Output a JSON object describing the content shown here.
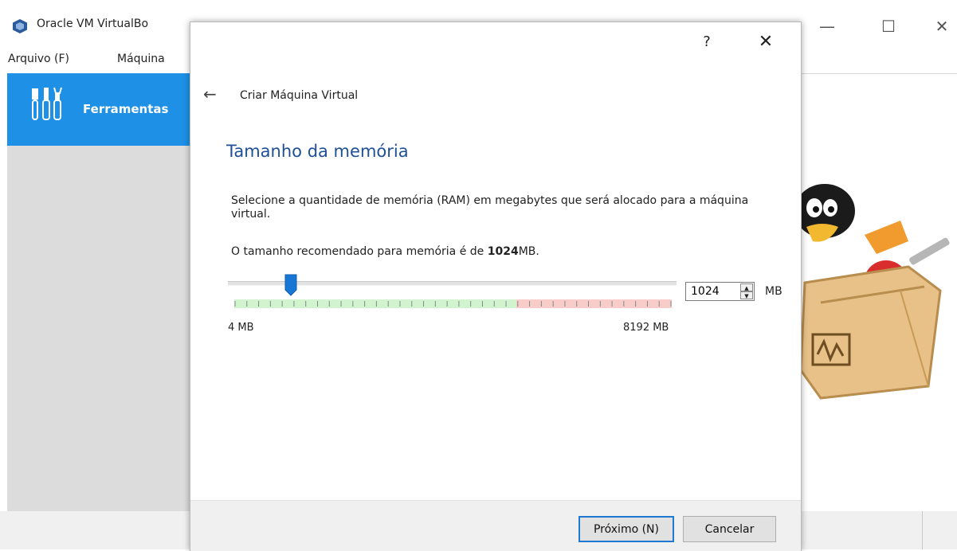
{
  "main_window": {
    "title": "Oracle VM VirtualBo",
    "controls": {
      "minimize": "—",
      "maximize": "☐",
      "close": "✕"
    },
    "menu": {
      "arquivo": "Arquivo (F)",
      "maquina": "Máquina"
    },
    "sidebar": {
      "tools_label": "Ferramentas"
    }
  },
  "dialog": {
    "help": "?",
    "close": "✕",
    "back": "←",
    "wizard_title": "Criar Máquina Virtual",
    "heading": "Tamanho da memória",
    "description": "Selecione a quantidade de memória (RAM) em megabytes que será alocado para a máquina virtual.",
    "recommended_prefix": "O tamanho recomendado para memória é de ",
    "recommended_value": "1024",
    "recommended_suffix": "MB.",
    "memory": {
      "value": "1024",
      "unit": "MB",
      "min_label": "4 MB",
      "max_label": "8192 MB",
      "min": 4,
      "max": 8192,
      "selected": 1024
    },
    "buttons": {
      "next": "Próximo (N)",
      "cancel": "Cancelar"
    }
  },
  "colors": {
    "accent": "#1e90e6",
    "heading": "#1f4f97",
    "safe_range": "#d1f3cd",
    "warning_range": "#f8cdc9"
  },
  "icons": {
    "logo": "virtualbox-logo-icon",
    "tools": "tools-icon",
    "back": "back-arrow-icon",
    "thumb": "slider-thumb-icon"
  }
}
